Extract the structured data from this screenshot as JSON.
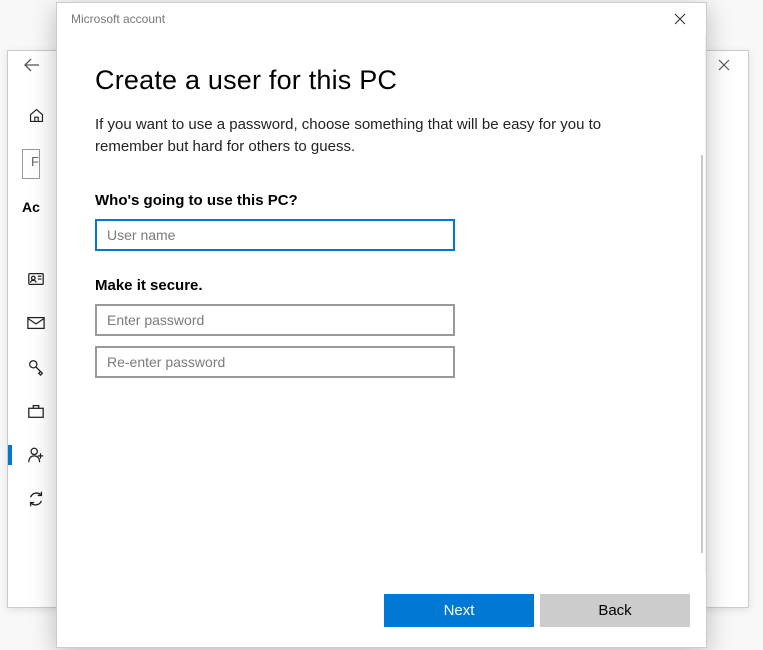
{
  "bg": {
    "search": "F",
    "heading": "Ac"
  },
  "modal": {
    "window_title": "Microsoft account",
    "heading": "Create a user for this PC",
    "description": "If you want to use a password, choose something that will be easy for you to remember but hard for others to guess.",
    "section_who": "Who's going to use this PC?",
    "username_placeholder": "User name",
    "section_secure": "Make it secure.",
    "password_placeholder": "Enter password",
    "reenter_placeholder": "Re-enter password",
    "next_label": "Next",
    "back_label": "Back"
  }
}
